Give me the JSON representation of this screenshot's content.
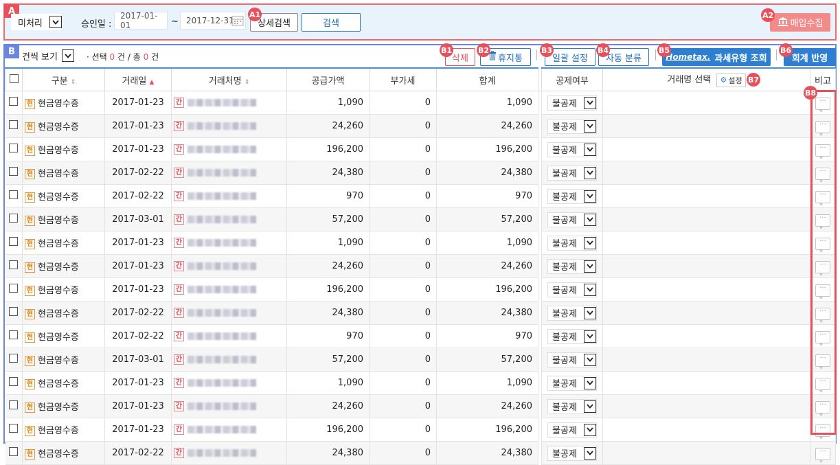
{
  "sectionA": {
    "tag": "A",
    "status_select": "미처리",
    "approval_label": "승인일 :",
    "date_from": "2017-01-01",
    "tilde": "~",
    "date_to": "2017-12-31",
    "detail_search_label": "상세검색",
    "search_label": "검색",
    "collect_label": "매입수집",
    "badges": {
      "a1": "A1",
      "a2": "A2"
    }
  },
  "sectionB": {
    "tag": "B",
    "view_select": "건씩 보기",
    "selection_text_prefix": "· 선택",
    "selected_count": "0",
    "selection_text_mid": "건 / 총",
    "total_count": "0",
    "selection_text_suffix": "건",
    "toolbar": {
      "delete": "삭제",
      "trash": "휴지통",
      "bulk_setting": "일괄 설정",
      "auto_classify": "자동 분류",
      "hometax_logo": "Hometax.",
      "tax_type_lookup": "과세유형 조회",
      "accounting_apply": "회계 반영"
    },
    "badges": {
      "b1": "B1",
      "b2": "B2",
      "b3": "B3",
      "b4": "B4",
      "b5": "B5",
      "b6": "B6",
      "b7": "B7",
      "b8": "B8"
    }
  },
  "table": {
    "headers": {
      "type": "구분",
      "date": "거래일",
      "vendor": "거래처명",
      "supply": "공급가액",
      "vat": "부가세",
      "total": "합계",
      "deduction": "공제여부",
      "item_select": "거래명 선택",
      "setting": "설정",
      "note": "비고"
    },
    "type_badge": "현",
    "vendor_badge": "간",
    "rows": [
      {
        "type": "현금영수증",
        "date": "2017-01-23",
        "supply": "1,090",
        "vat": "0",
        "total": "1,090",
        "deduction": "불공제"
      },
      {
        "type": "현금영수증",
        "date": "2017-01-23",
        "supply": "24,260",
        "vat": "0",
        "total": "24,260",
        "deduction": "불공제"
      },
      {
        "type": "현금영수증",
        "date": "2017-01-23",
        "supply": "196,200",
        "vat": "0",
        "total": "196,200",
        "deduction": "불공제"
      },
      {
        "type": "현금영수증",
        "date": "2017-02-22",
        "supply": "24,380",
        "vat": "0",
        "total": "24,380",
        "deduction": "불공제"
      },
      {
        "type": "현금영수증",
        "date": "2017-02-22",
        "supply": "970",
        "vat": "0",
        "total": "970",
        "deduction": "불공제"
      },
      {
        "type": "현금영수증",
        "date": "2017-03-01",
        "supply": "57,200",
        "vat": "0",
        "total": "57,200",
        "deduction": "불공제"
      },
      {
        "type": "현금영수증",
        "date": "2017-01-23",
        "supply": "1,090",
        "vat": "0",
        "total": "1,090",
        "deduction": "불공제"
      },
      {
        "type": "현금영수증",
        "date": "2017-01-23",
        "supply": "24,260",
        "vat": "0",
        "total": "24,260",
        "deduction": "불공제"
      },
      {
        "type": "현금영수증",
        "date": "2017-01-23",
        "supply": "196,200",
        "vat": "0",
        "total": "196,200",
        "deduction": "불공제"
      },
      {
        "type": "현금영수증",
        "date": "2017-02-22",
        "supply": "24,380",
        "vat": "0",
        "total": "24,380",
        "deduction": "불공제"
      },
      {
        "type": "현금영수증",
        "date": "2017-02-22",
        "supply": "970",
        "vat": "0",
        "total": "970",
        "deduction": "불공제"
      },
      {
        "type": "현금영수증",
        "date": "2017-03-01",
        "supply": "57,200",
        "vat": "0",
        "total": "57,200",
        "deduction": "불공제"
      },
      {
        "type": "현금영수증",
        "date": "2017-01-23",
        "supply": "1,090",
        "vat": "0",
        "total": "1,090",
        "deduction": "불공제"
      },
      {
        "type": "현금영수증",
        "date": "2017-01-23",
        "supply": "24,260",
        "vat": "0",
        "total": "24,260",
        "deduction": "불공제"
      },
      {
        "type": "현금영수증",
        "date": "2017-01-23",
        "supply": "196,200",
        "vat": "0",
        "total": "196,200",
        "deduction": "불공제"
      },
      {
        "type": "현금영수증",
        "date": "2017-02-22",
        "supply": "24,380",
        "vat": "0",
        "total": "24,380",
        "deduction": "불공제"
      }
    ]
  },
  "colors": {
    "accent_blue": "#2a78c9",
    "badge_red": "#e8505b",
    "section_a_bg": "#e9f3fc"
  }
}
